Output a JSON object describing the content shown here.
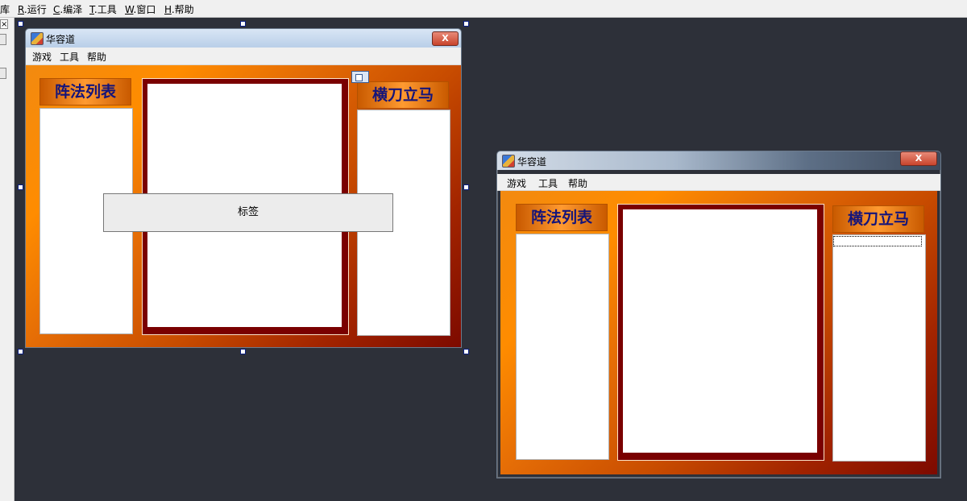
{
  "ide_menu": [
    {
      "key": "",
      "rest": "库"
    },
    {
      "key": "R",
      "rest": ".运行"
    },
    {
      "key": "C",
      "rest": ".编泽"
    },
    {
      "key": "T",
      "rest": ".工具"
    },
    {
      "key": "W",
      "rest": ".窗口"
    },
    {
      "key": "H",
      "rest": ".帮助"
    }
  ],
  "ide_close": "×",
  "design_window": {
    "title": "华容道",
    "close": "X",
    "menu": [
      "游戏",
      "工具",
      "帮助"
    ],
    "left_title": "阵法列表",
    "right_title": "横刀立马",
    "label_text": "标签"
  },
  "preview_window": {
    "title": "华容道",
    "close": "X",
    "menu": [
      "游戏",
      "工具",
      "帮助"
    ],
    "left_title": "阵法列表",
    "right_title": "横刀立马"
  }
}
